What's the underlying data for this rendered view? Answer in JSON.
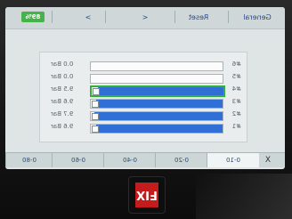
{
  "topbar": {
    "battery": "89%",
    "nav_forward": ">",
    "nav_back": "<",
    "reset": "Reset",
    "general": "General"
  },
  "rows": [
    {
      "id": "#6",
      "value": "0.0 Bar",
      "level": 0
    },
    {
      "id": "#5",
      "value": "0.0 Bar",
      "level": 0
    },
    {
      "id": "#4",
      "value": "9.5 Bar",
      "level": 0.95,
      "selected": true
    },
    {
      "id": "#3",
      "value": "9.6 Bar",
      "level": 0.96
    },
    {
      "id": "#2",
      "value": "9.7 Bar",
      "level": 0.97
    },
    {
      "id": "#1",
      "value": "9.6 Bar",
      "level": 0.96
    }
  ],
  "tabs": [
    "0-80",
    "0-60",
    "0-40",
    "0-20",
    "0-10"
  ],
  "active_tab": "0-10",
  "close_label": "X",
  "logo_text": "FIX",
  "colors": {
    "fill": "#2f6fd6",
    "selected": "#34b03a",
    "battery": "#46b34a"
  }
}
